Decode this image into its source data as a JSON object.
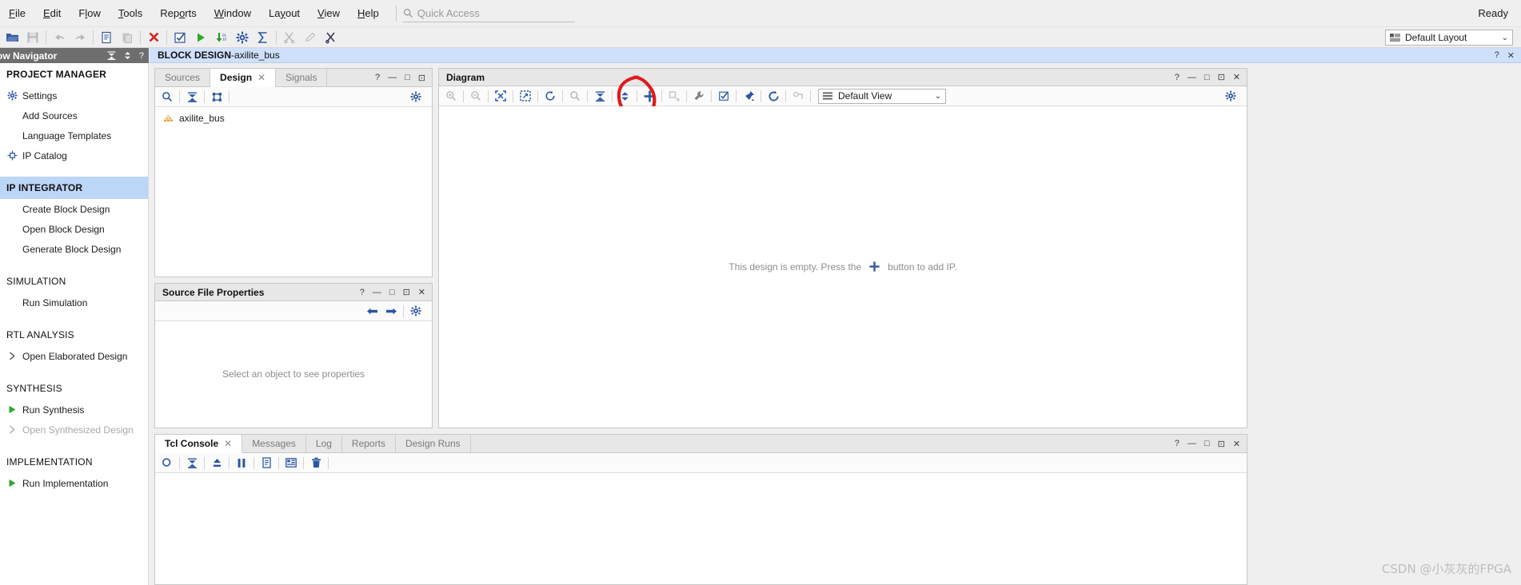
{
  "app": {
    "status": "Ready",
    "watermark": "CSDN @小灰灰的FPGA"
  },
  "menubar": {
    "items": [
      {
        "label": "File"
      },
      {
        "label": "Edit"
      },
      {
        "label": "Flow"
      },
      {
        "label": "Tools"
      },
      {
        "label": "Reports"
      },
      {
        "label": "Window"
      },
      {
        "label": "Layout"
      },
      {
        "label": "View"
      },
      {
        "label": "Help"
      }
    ],
    "quick_access_placeholder": "Quick Access"
  },
  "toolbar": {
    "buttons": [
      {
        "name": "open-project-icon",
        "enabled": true
      },
      {
        "name": "save-icon",
        "enabled": false
      },
      {
        "name": "undo-icon",
        "enabled": false
      },
      {
        "name": "redo-icon",
        "enabled": false
      },
      {
        "name": "copy-icon",
        "enabled": true
      },
      {
        "name": "paste-icon",
        "enabled": false
      },
      {
        "name": "close-x-icon",
        "enabled": true
      },
      {
        "name": "validate-check-icon",
        "enabled": true
      },
      {
        "name": "run-play-icon",
        "enabled": true
      },
      {
        "name": "generate-bitstream-icon",
        "enabled": true
      },
      {
        "name": "settings-gear-icon",
        "enabled": true
      },
      {
        "name": "report-sigma-icon",
        "enabled": true
      },
      {
        "name": "cut-scissors-icon",
        "enabled": false
      },
      {
        "name": "edit-pencil-icon",
        "enabled": false
      },
      {
        "name": "marker-icon",
        "enabled": true
      }
    ],
    "layout_label": "Default Layout"
  },
  "navigator": {
    "header_title": "ow Navigator",
    "sections": [
      {
        "title": "PROJECT MANAGER",
        "highlighted": false,
        "bold": true,
        "items": [
          {
            "label": "Settings",
            "icon": "gear-icon",
            "disabled": false
          },
          {
            "label": "Add Sources",
            "icon": "none",
            "disabled": false
          },
          {
            "label": "Language Templates",
            "icon": "none",
            "disabled": false
          },
          {
            "label": "IP Catalog",
            "icon": "ip-catalog-icon",
            "disabled": false
          }
        ]
      },
      {
        "title": "IP INTEGRATOR",
        "highlighted": true,
        "bold": true,
        "items": [
          {
            "label": "Create Block Design",
            "icon": "none",
            "disabled": false
          },
          {
            "label": "Open Block Design",
            "icon": "none",
            "disabled": false
          },
          {
            "label": "Generate Block Design",
            "icon": "none",
            "disabled": false
          }
        ]
      },
      {
        "title": "SIMULATION",
        "highlighted": false,
        "bold": false,
        "items": [
          {
            "label": "Run Simulation",
            "icon": "none",
            "disabled": false
          }
        ]
      },
      {
        "title": "RTL ANALYSIS",
        "highlighted": false,
        "bold": false,
        "items": [
          {
            "label": "Open Elaborated Design",
            "icon": "chevron-right-icon",
            "disabled": false
          }
        ]
      },
      {
        "title": "SYNTHESIS",
        "highlighted": false,
        "bold": false,
        "items": [
          {
            "label": "Run Synthesis",
            "icon": "play-icon",
            "disabled": false
          },
          {
            "label": "Open Synthesized Design",
            "icon": "chevron-right-icon",
            "disabled": true
          }
        ]
      },
      {
        "title": "IMPLEMENTATION",
        "highlighted": false,
        "bold": false,
        "items": [
          {
            "label": "Run Implementation",
            "icon": "play-icon",
            "disabled": false
          }
        ]
      }
    ]
  },
  "block_design_header": {
    "prefix": "BLOCK DESIGN",
    "separator": " - ",
    "name": "axilite_bus"
  },
  "design_panel": {
    "tabs": [
      {
        "label": "Sources",
        "active": false,
        "closable": false
      },
      {
        "label": "Design",
        "active": true,
        "closable": true
      },
      {
        "label": "Signals",
        "active": false,
        "closable": false
      }
    ],
    "toolbar": [
      {
        "name": "search-icon"
      },
      {
        "name": "collapse-all-icon"
      },
      {
        "name": "hierarchy-icon"
      }
    ],
    "tree": [
      {
        "label": "axilite_bus",
        "icon": "block-design-icon"
      }
    ]
  },
  "source_file_properties": {
    "title": "Source File Properties",
    "empty_text": "Select an object to see properties",
    "toolbar": [
      {
        "name": "back-arrow-icon"
      },
      {
        "name": "forward-arrow-icon"
      },
      {
        "name": "gear-icon"
      }
    ]
  },
  "diagram": {
    "title": "Diagram",
    "toolbar": [
      {
        "name": "zoom-in-icon",
        "enabled": false
      },
      {
        "name": "zoom-out-icon",
        "enabled": false
      },
      {
        "name": "zoom-fit-icon",
        "enabled": true
      },
      {
        "name": "zoom-area-icon",
        "enabled": true
      },
      {
        "name": "redraw-icon",
        "enabled": true
      },
      {
        "name": "search-icon",
        "enabled": false
      },
      {
        "name": "collapse-all-icon",
        "enabled": true
      },
      {
        "name": "expand-all-icon",
        "enabled": true
      },
      {
        "name": "add-ip-plus-icon",
        "enabled": true
      },
      {
        "name": "add-module-icon",
        "enabled": false
      },
      {
        "name": "run-connection-automation-wrench-icon",
        "enabled": true
      },
      {
        "name": "validate-design-icon",
        "enabled": true
      },
      {
        "name": "pin-icon",
        "enabled": true
      },
      {
        "name": "regenerate-layout-icon",
        "enabled": true
      },
      {
        "name": "optimize-routing-icon",
        "enabled": false
      }
    ],
    "view_label": "Default View",
    "empty_message_before": "This design is empty. Press the",
    "empty_message_after": "button to add IP.",
    "annotation": {
      "shape": "hand-drawn-circle",
      "color": "#e01b1b",
      "target": "add-ip-plus-icon"
    }
  },
  "console": {
    "tabs": [
      {
        "label": "Tcl Console",
        "active": true,
        "closable": true
      },
      {
        "label": "Messages",
        "active": false,
        "closable": false
      },
      {
        "label": "Log",
        "active": false,
        "closable": false
      },
      {
        "label": "Reports",
        "active": false,
        "closable": false
      },
      {
        "label": "Design Runs",
        "active": false,
        "closable": false
      }
    ],
    "toolbar": [
      {
        "name": "search-console-icon"
      },
      {
        "name": "collapse-icon"
      },
      {
        "name": "export-icon"
      },
      {
        "name": "pause-icon"
      },
      {
        "name": "copy-log-icon"
      },
      {
        "name": "columns-icon"
      },
      {
        "name": "clear-trash-icon"
      }
    ]
  },
  "panel_controls": {
    "help": "?",
    "minimize": "—",
    "maximize": "□",
    "float": "⊡",
    "close": "✕"
  },
  "colors": {
    "accent_blue": "#3a5a9b",
    "highlight_blue": "#bcd6f7",
    "title_blue": "#cfe0fb",
    "annotation_red": "#e01b1b",
    "green_play": "#2fa82f",
    "red_x": "#d82020"
  }
}
